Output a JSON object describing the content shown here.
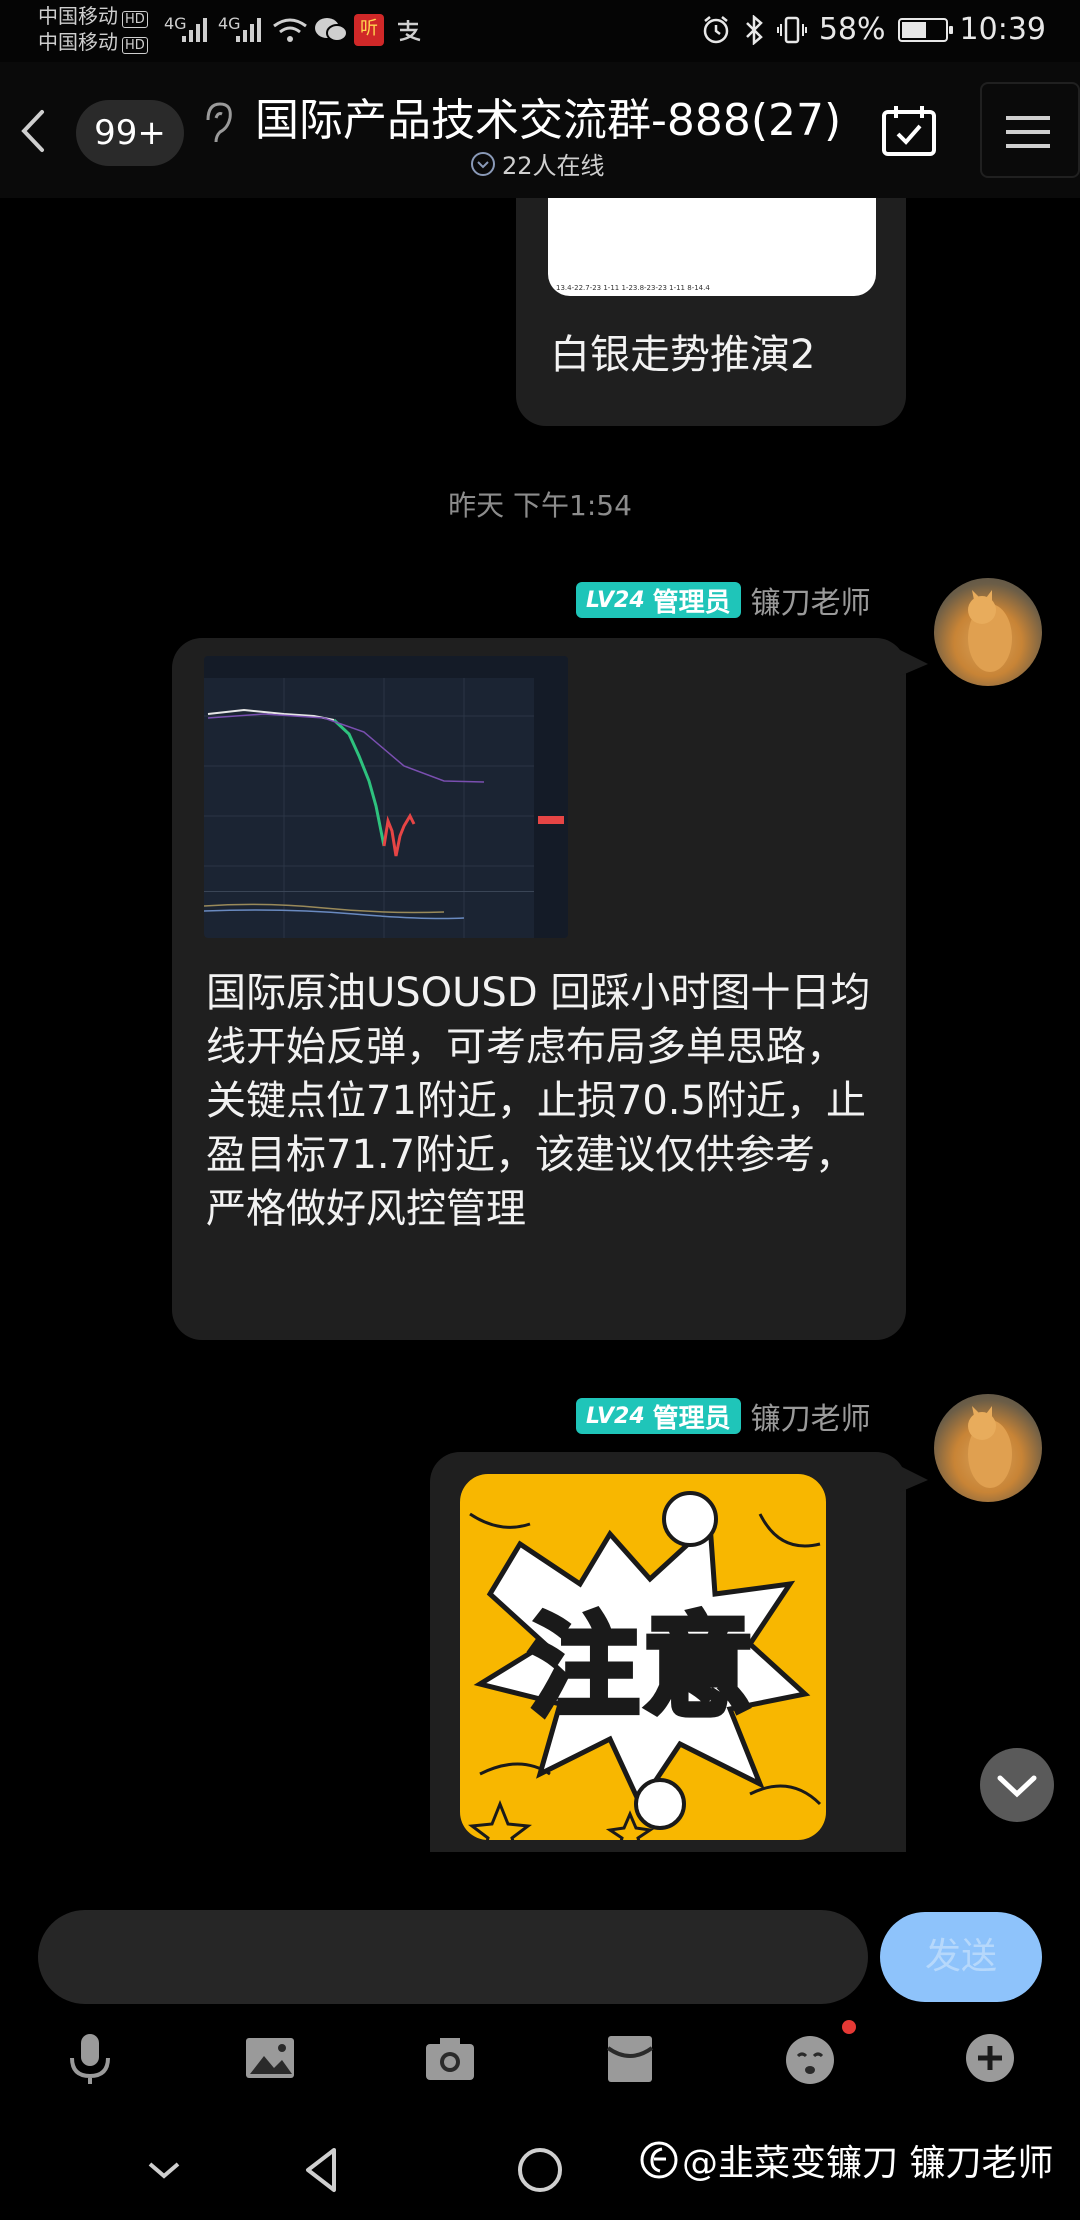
{
  "status_bar": {
    "carrier1": "中国移动",
    "carrier2": "中国移动",
    "hd": "HD",
    "net1": "4G",
    "net2": "4G",
    "app_icon_text": "听",
    "battery_percent": "58%",
    "battery_level": 0.58,
    "time": "10:39"
  },
  "header": {
    "unread_count": "99+",
    "group_title": "国际产品技术交流群-888(27)",
    "online_text": "22人在线"
  },
  "messages": {
    "previous_card_text": "白银走势推演2",
    "previous_card_axis": "13.4-22.7-23 1-11 1-23.8-23-23 1-11 8-14.4",
    "timestamp": "昨天 下午1:54",
    "message1": {
      "level": "LV24",
      "role": "管理员",
      "sender": "镰刀老师",
      "text": "国际原油USOUSD 回踩小时图十日均线开始反弹，可考虑布局多单思路，关键点位71附近，止损70.5附近，止盈目标71.7附近，该建议仅供参考，严格做好风控管理"
    },
    "message2": {
      "level": "LV24",
      "role": "管理员",
      "sender": "镰刀老师",
      "sticker_text": "注意"
    }
  },
  "input": {
    "placeholder": "",
    "send_label": "发送"
  },
  "watermark": "@韭菜变镰刀 镰刀老师",
  "colors": {
    "badge": "#1fc5b9",
    "send_button": "#8ec3fb",
    "bubble": "#1f1f1f",
    "sticker": "#f8b700"
  }
}
